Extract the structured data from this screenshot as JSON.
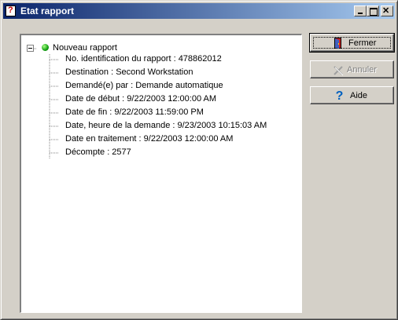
{
  "window": {
    "title": "Etat rapport"
  },
  "tree": {
    "root_label": "Nouveau rapport",
    "root_status": "green",
    "items": [
      "No. identification du rapport : 478862012",
      "Destination : Second Workstation",
      "Demandé(e) par : Demande automatique",
      "Date de début : 9/22/2003 12:00:00 AM",
      "Date de fin : 9/22/2003 11:59:00 PM",
      "Date, heure de la demande : 9/23/2003 10:15:03 AM",
      "Date en traitement : 9/22/2003 12:00:00 AM",
      "Décompte : 2577"
    ]
  },
  "buttons": {
    "close_label": "Fermer",
    "cancel_label": "Annuler",
    "help_label": "Aide"
  },
  "colors": {
    "titlebar_start": "#0a246a",
    "titlebar_end": "#a6caf0",
    "status_green": "#10a010",
    "help_blue": "#0060c0"
  }
}
